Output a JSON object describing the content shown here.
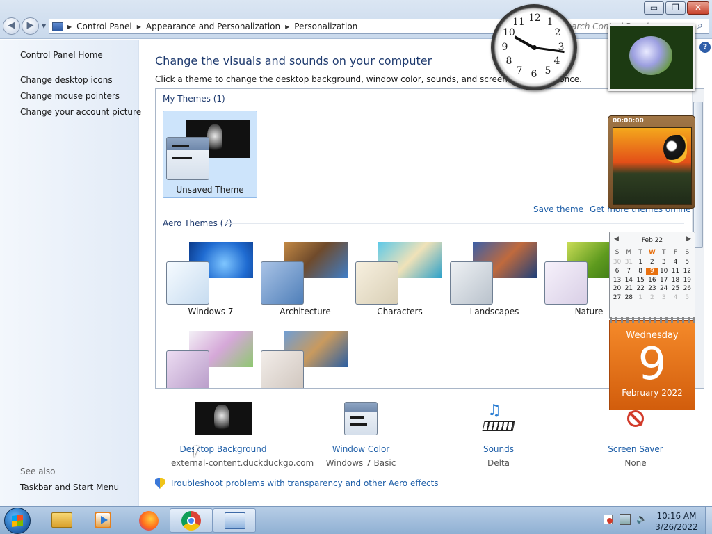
{
  "window": {
    "caption_minimize": "▭",
    "caption_maximize": "❐",
    "caption_close": "✕",
    "back_glyph": "◀",
    "forward_glyph": "▶",
    "breadcrumb": [
      "Control Panel",
      "Appearance and Personalization",
      "Personalization"
    ],
    "search_placeholder": "Search Control Panel",
    "help_glyph": "?"
  },
  "sidebar": {
    "home": "Control Panel Home",
    "links": [
      "Change desktop icons",
      "Change mouse pointers",
      "Change your account picture"
    ],
    "see_also_heading": "See also",
    "see_also": [
      "Taskbar and Start Menu"
    ]
  },
  "main": {
    "title": "Change the visuals and sounds on your computer",
    "subtitle": "Click a theme to change the desktop background, window color, sounds, and screen saver all at once.",
    "my_themes_heading": "My Themes (1)",
    "unsaved_theme": "Unsaved Theme",
    "save_theme": "Save theme",
    "get_more": "Get more themes online",
    "aero_heading": "Aero Themes (7)",
    "aero_themes": [
      "Windows 7",
      "Architecture",
      "Characters",
      "Landscapes",
      "Nature"
    ],
    "bottom": [
      {
        "label": "Desktop Background",
        "value": "external-content.duckduckgo.com"
      },
      {
        "label": "Window Color",
        "value": "Windows 7 Basic"
      },
      {
        "label": "Sounds",
        "value": "Delta"
      },
      {
        "label": "Screen Saver",
        "value": "None"
      }
    ],
    "troubleshoot": "Troubleshoot problems with transparency and other Aero effects"
  },
  "gadgets": {
    "clock_numbers": [
      "12",
      "1",
      "2",
      "3",
      "4",
      "5",
      "6",
      "7",
      "8",
      "9",
      "10",
      "11"
    ],
    "puzzle_timer": "00:00:00",
    "calendar": {
      "month": "Feb 22",
      "weekdays": [
        "S",
        "M",
        "T",
        "W",
        "T",
        "F",
        "S"
      ],
      "weeks": [
        [
          "30",
          "31",
          "1",
          "2",
          "3",
          "4",
          "5"
        ],
        [
          "6",
          "7",
          "8",
          "9",
          "10",
          "11",
          "12"
        ],
        [
          "13",
          "14",
          "15",
          "16",
          "17",
          "18",
          "19"
        ],
        [
          "20",
          "21",
          "22",
          "23",
          "24",
          "25",
          "26"
        ],
        [
          "27",
          "28",
          "1",
          "2",
          "3",
          "4",
          "5"
        ]
      ],
      "day_name": "Wednesday",
      "day_number": "9",
      "month_year": "February 2022"
    }
  },
  "taskbar": {
    "time": "10:16 AM",
    "date": "3/26/2022"
  },
  "colors": {
    "link": "#1f5fa8",
    "heading": "#1e3a6e",
    "selection": "#cde4fb",
    "calendar_accent": "#e8700f"
  }
}
